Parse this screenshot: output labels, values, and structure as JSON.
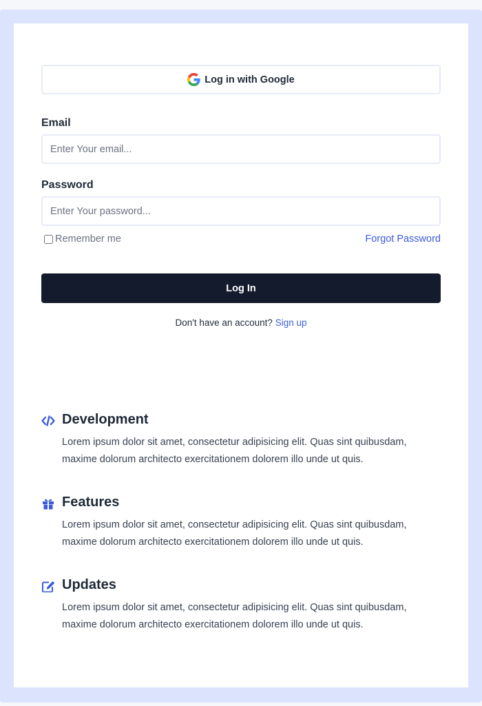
{
  "login": {
    "google_button_label": "Log in with Google",
    "email_label": "Email",
    "email_placeholder": "Enter Your email...",
    "password_label": "Password",
    "password_placeholder": "Enter Your password...",
    "remember_label": "Remember me",
    "forgot_label": "Forgot Password",
    "submit_label": "Log In",
    "signup_prompt": "Don't have an account?",
    "signup_link": "Sign up"
  },
  "features": [
    {
      "icon": "code-icon",
      "title": "Development",
      "description": "Lorem ipsum dolor sit amet, consectetur adipisicing elit. Quas sint quibusdam, maxime dolorum architecto exercitationem dolorem illo unde ut quis."
    },
    {
      "icon": "gift-icon",
      "title": "Features",
      "description": "Lorem ipsum dolor sit amet, consectetur adipisicing elit. Quas sint quibusdam, maxime dolorum architecto exercitationem dolorem illo unde ut quis."
    },
    {
      "icon": "edit-icon",
      "title": "Updates",
      "description": "Lorem ipsum dolor sit amet, consectetur adipisicing elit. Quas sint quibusdam, maxime dolorum architecto exercitationem dolorem illo unde ut quis."
    }
  ],
  "colors": {
    "accent": "#3b5bdb",
    "button_dark": "#141b2d",
    "frame": "#dbe4fc"
  }
}
